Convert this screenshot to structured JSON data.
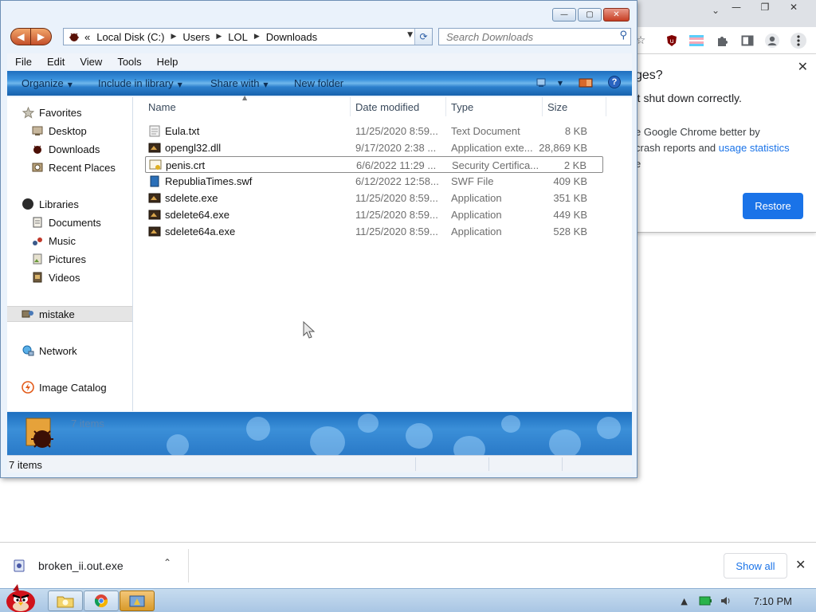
{
  "chrome": {
    "minimize_glyph": "—",
    "maximize_glyph": "❐",
    "close_glyph": "✕",
    "tabs_dropdown_glyph": "⌄",
    "toolbar_icons": [
      "star-icon",
      "ublock-icon",
      "profile-flag-icon",
      "extensions-icon",
      "sidebar-icon",
      "account-icon",
      "menu-icon"
    ],
    "restore_bubble": {
      "title": "ges?",
      "message": "'t shut down correctly.",
      "help_line1": "e Google Chrome better by",
      "help_line2_prefix": "crash reports and ",
      "help_link": "usage statistics",
      "help_line3": "e",
      "restore_label": "Restore",
      "close_glyph": "✕"
    }
  },
  "download_bar": {
    "file_name": "broken_ii.out.exe",
    "caret_glyph": "⌃",
    "show_all_label": "Show all",
    "close_glyph": "✕"
  },
  "taskbar": {
    "clock": "7:10 PM"
  },
  "explorer": {
    "controls": {
      "minimize": "—",
      "maximize": "▢",
      "close": "✕"
    },
    "nav": {
      "back_glyph": "◀",
      "forward_glyph": "▶"
    },
    "address": {
      "prefix": "«",
      "crumbs": [
        "Local Disk (C:)",
        "Users",
        "LOL",
        "Downloads"
      ],
      "separator": "▶",
      "dropdown_glyph": "▼",
      "refresh_glyph": "⟳"
    },
    "search": {
      "placeholder": "Search Downloads",
      "value": "",
      "icon_glyph": "⚲"
    },
    "menu": [
      "File",
      "Edit",
      "View",
      "Tools",
      "Help"
    ],
    "commands": {
      "organize": "Organize",
      "include_in_library": "Include in library",
      "share_with": "Share with",
      "new_folder": "New folder",
      "help_glyph": "?"
    },
    "nav_pane": {
      "favorites_label": "Favorites",
      "favorites": [
        "Desktop",
        "Downloads",
        "Recent Places"
      ],
      "libraries_label": "Libraries",
      "libraries": [
        "Documents",
        "Music",
        "Pictures",
        "Videos"
      ],
      "selected_item": "mistake",
      "network_label": "Network",
      "image_catalog_label": "Image Catalog"
    },
    "columns": [
      "Name",
      "Date modified",
      "Type",
      "Size"
    ],
    "files": [
      {
        "name": "Eula.txt",
        "date": "11/25/2020 8:59...",
        "type": "Text Document",
        "size": "8 KB"
      },
      {
        "name": "opengl32.dll",
        "date": "9/17/2020 2:38 ...",
        "type": "Application exte...",
        "size": "28,869 KB"
      },
      {
        "name": "penis.crt",
        "date": "6/6/2022 11:29 ...",
        "type": "Security Certifica...",
        "size": "2 KB"
      },
      {
        "name": "RepubliaTimes.swf",
        "date": "6/12/2022 12:58...",
        "type": "SWF File",
        "size": "409 KB"
      },
      {
        "name": "sdelete.exe",
        "date": "11/25/2020 8:59...",
        "type": "Application",
        "size": "351 KB"
      },
      {
        "name": "sdelete64.exe",
        "date": "11/25/2020 8:59...",
        "type": "Application",
        "size": "449 KB"
      },
      {
        "name": "sdelete64a.exe",
        "date": "11/25/2020 8:59...",
        "type": "Application",
        "size": "528 KB"
      }
    ],
    "details_text": "7 items",
    "status_text": "7 items"
  },
  "colors": {
    "chrome_accent": "#1a73e8",
    "explorer_frame": "#eaf2fb",
    "command_bar": "#2c7fcc"
  }
}
